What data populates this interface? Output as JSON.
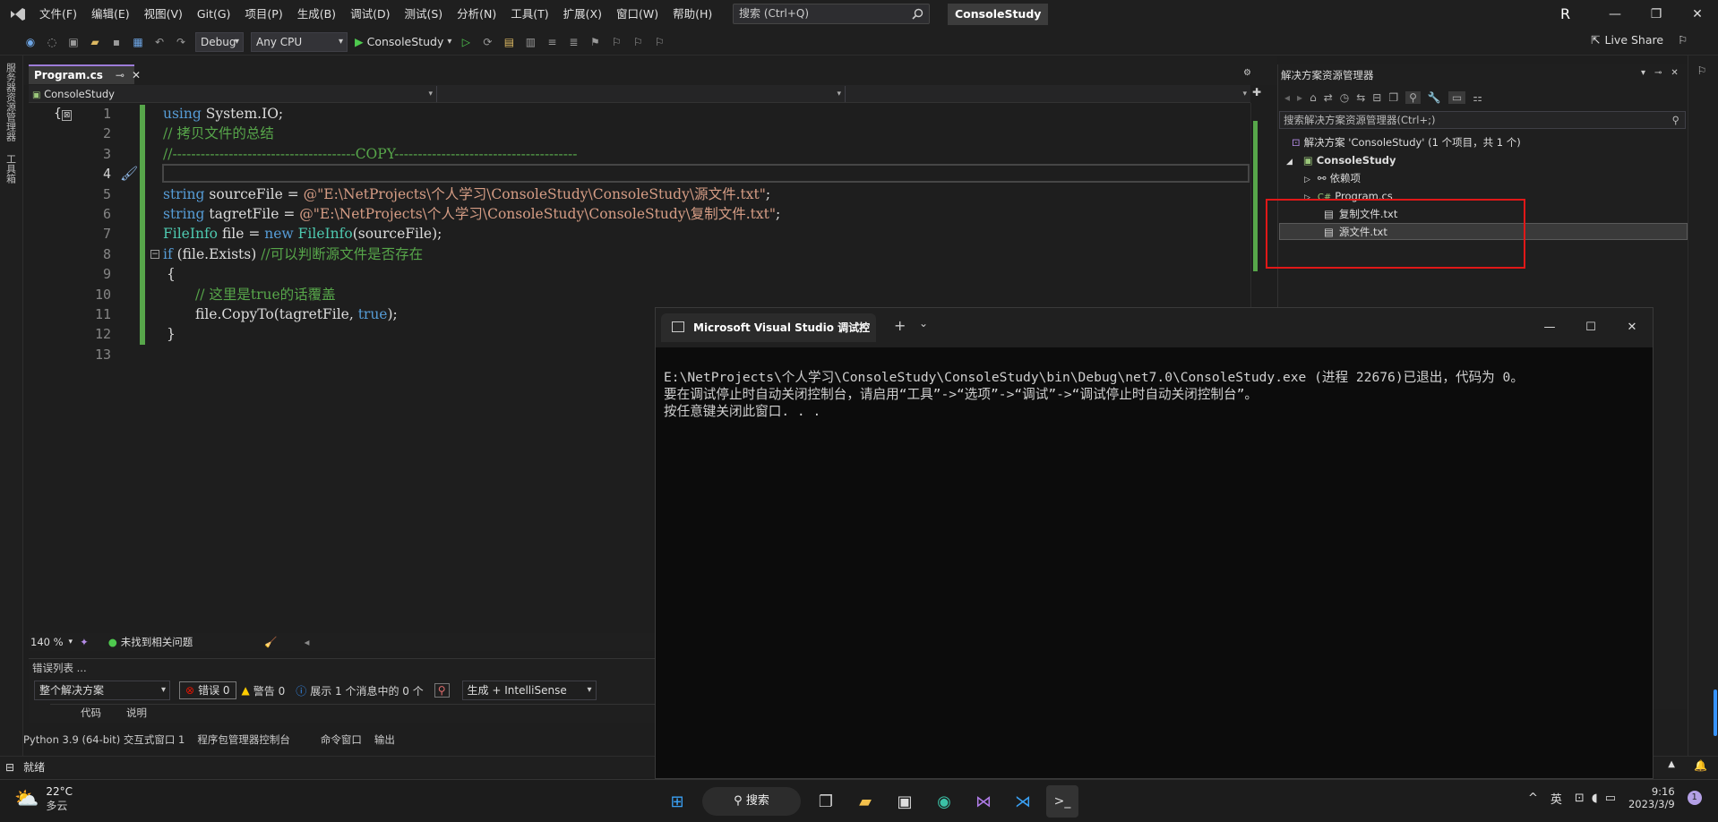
{
  "titlebar": {
    "menus": [
      "文件(F)",
      "编辑(E)",
      "视图(V)",
      "Git(G)",
      "项目(P)",
      "生成(B)",
      "调试(D)",
      "测试(S)",
      "分析(N)",
      "工具(T)",
      "扩展(X)",
      "窗口(W)",
      "帮助(H)"
    ],
    "search_placeholder": "搜索 (Ctrl+Q)",
    "project": "ConsoleStudy",
    "avatar": "R"
  },
  "toolbar": {
    "config": "Debug",
    "platform": "Any CPU",
    "run_label": "ConsoleStudy",
    "live_share": "Live Share"
  },
  "leftstrip": {
    "items": [
      "服务器资源管理器",
      "工具箱"
    ]
  },
  "editor": {
    "tab": "Program.cs",
    "nav_project": "ConsoleStudy",
    "zoom": "140 %",
    "issues": "未找到相关问题",
    "line_numbers": [
      "1",
      "2",
      "3",
      "4",
      "5",
      "6",
      "7",
      "8",
      "9",
      "10",
      "11",
      "12",
      "13"
    ],
    "code": {
      "l1a": "using",
      "l1b": " System.IO;",
      "l2": "// 拷贝文件的总结",
      "l3": "//---------------------------------------COPY---------------------------------------",
      "l5a": "string",
      "l5b": " sourceFile = ",
      "l5c": "@\"E:\\NetProjects\\个人学习\\ConsoleStudy\\ConsoleStudy\\源文件.txt\"",
      "l5d": ";",
      "l6a": "string",
      "l6b": " tagretFile = ",
      "l6c": "@\"E:\\NetProjects\\个人学习\\ConsoleStudy\\ConsoleStudy\\复制文件.txt\"",
      "l6d": ";",
      "l7a": "FileInfo",
      "l7b": " file = ",
      "l7c": "new",
      "l7d": " ",
      "l7e": "FileInfo",
      "l7f": "(sourceFile);",
      "l8a": "if",
      "l8b": " (file.Exists) ",
      "l8c": "//可以判断源文件是否存在",
      "l9": "{",
      "l10": "// 这里是true的话覆盖",
      "l11a": "file.CopyTo(tagretFile, ",
      "l11b": "true",
      "l11c": ");",
      "l12": "}"
    }
  },
  "errorlist": {
    "title": "错误列表 ...",
    "scope": "整个解决方案",
    "errors": "错误 0",
    "warnings": "警告 0",
    "messages": "展示 1 个消息中的 0 个",
    "build": "生成 + IntelliSense",
    "col_code": "代码",
    "col_desc": "说明"
  },
  "bottomtabs": [
    "Python 3.9 (64-bit) 交互式窗口 1",
    "程序包管理器控制台",
    "命令窗口",
    "输出"
  ],
  "status": {
    "ready": "就绪"
  },
  "solution": {
    "title": "解决方案资源管理器",
    "search": "搜索解决方案资源管理器(Ctrl+;)",
    "root": "解决方案 'ConsoleStudy' (1 个项目，共 1 个)",
    "project": "ConsoleStudy",
    "deps": "依赖项",
    "program": "Program.cs",
    "copyfile": "复制文件.txt",
    "srcfile": "源文件.txt"
  },
  "console": {
    "tab": "Microsoft Visual Studio 调试控",
    "line1": "E:\\NetProjects\\个人学习\\ConsoleStudy\\ConsoleStudy\\bin\\Debug\\net7.0\\ConsoleStudy.exe (进程 22676)已退出，代码为 0。",
    "line2": "要在调试停止时自动关闭控制台，请启用“工具”->“选项”->“调试”->“调试停止时自动关闭控制台”。",
    "line3": "按任意键关闭此窗口. . ."
  },
  "taskbar": {
    "temp": "22°C",
    "weather": "多云",
    "search": "搜索",
    "ime": "英",
    "time": "9:16",
    "date": "2023/3/9",
    "notif": "1"
  }
}
